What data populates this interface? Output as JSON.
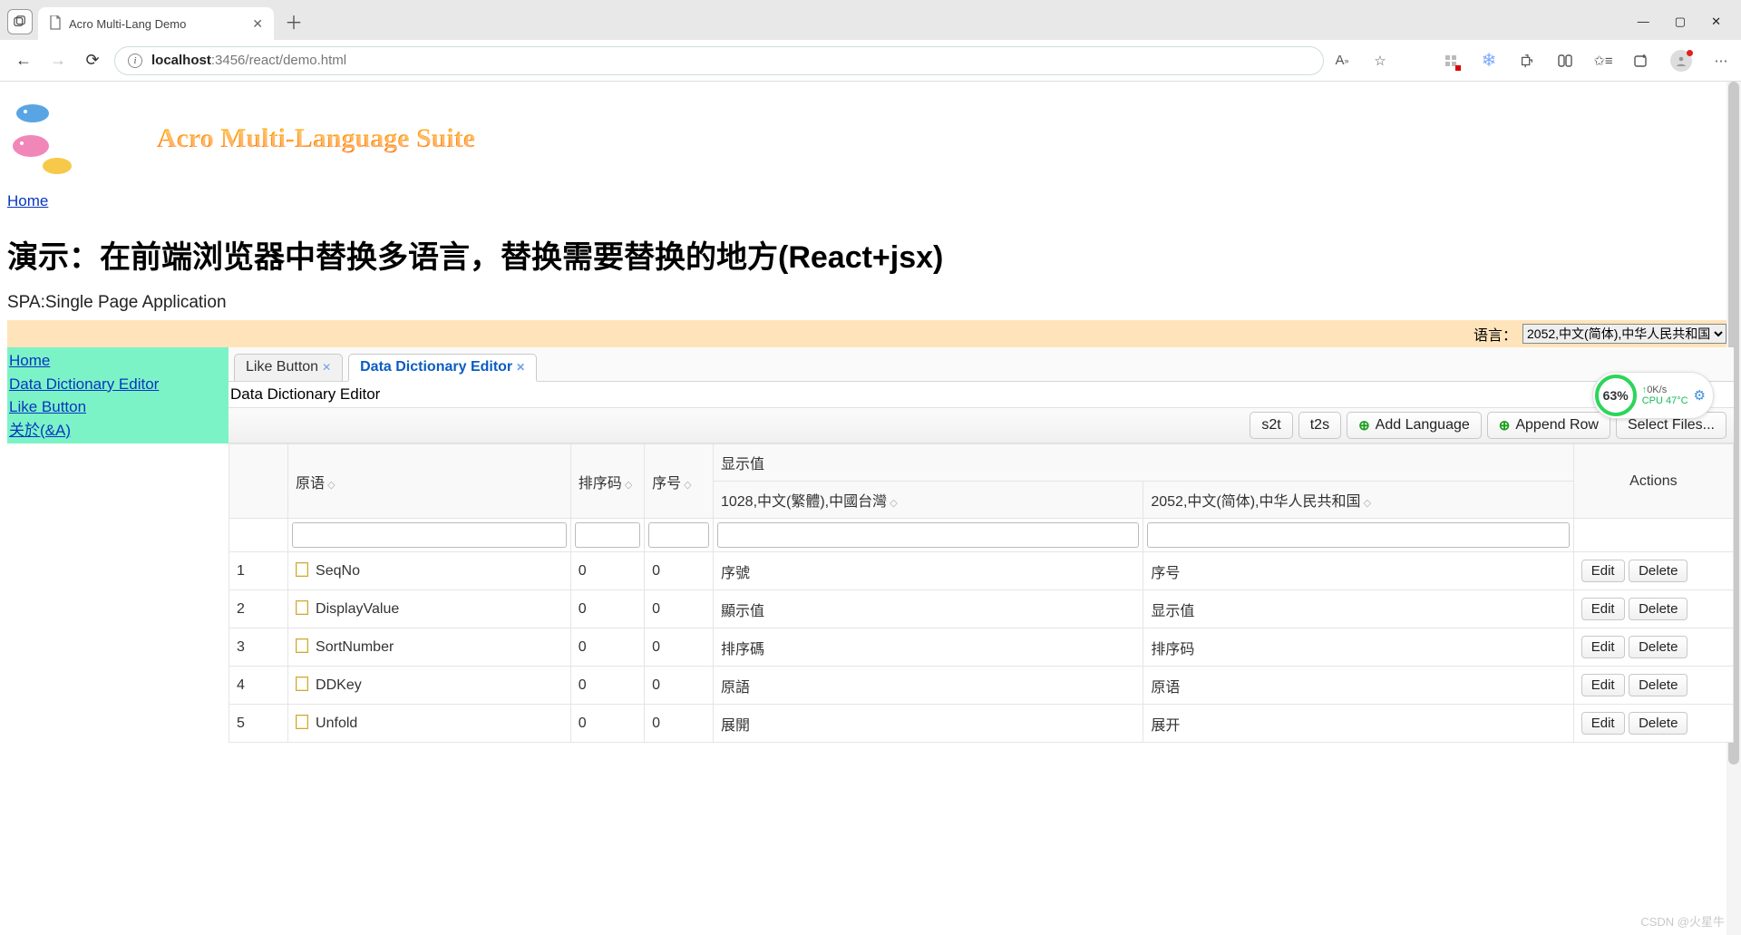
{
  "browser": {
    "tab_title": "Acro Multi-Lang Demo",
    "url_host": "localhost",
    "url_path": ":3456/react/demo.html"
  },
  "logo_text": "Acro Multi-Language Suite",
  "top_home_link": "Home",
  "page_title": "演示：在前端浏览器中替换多语言，替换需要替换的地方(React+jsx)",
  "subhead": "SPA:Single Page Application",
  "lang_bar": {
    "label": "语言：",
    "selected": "2052,中文(简体),中华人民共和国"
  },
  "sidebar": [
    "Home",
    "Data Dictionary Editor",
    "Like Button",
    "关於(&A)"
  ],
  "tabs": {
    "like_button": "Like Button",
    "data_dict": "Data Dictionary Editor"
  },
  "editor_title": "Data Dictionary Editor",
  "toolbar": {
    "s2t": "s2t",
    "t2s": "t2s",
    "add_lang": "Add Language",
    "append_row": "Append Row",
    "select_files": "Select Files..."
  },
  "columns": {
    "primary": "原语",
    "sort_num": "排序码",
    "seq_no": "序号",
    "display_val": "显示值",
    "tw": "1028,中文(繁體),中國台灣",
    "cn": "2052,中文(简体),中华人民共和国",
    "actions": "Actions"
  },
  "actions": {
    "edit": "Edit",
    "delete": "Delete"
  },
  "rows": [
    {
      "n": "1",
      "pk": "SeqNo",
      "sn": "0",
      "seq": "0",
      "tw": "序號",
      "cn": "序号"
    },
    {
      "n": "2",
      "pk": "DisplayValue",
      "sn": "0",
      "seq": "0",
      "tw": "顯示值",
      "cn": "显示值"
    },
    {
      "n": "3",
      "pk": "SortNumber",
      "sn": "0",
      "seq": "0",
      "tw": "排序碼",
      "cn": "排序码"
    },
    {
      "n": "4",
      "pk": "DDKey",
      "sn": "0",
      "seq": "0",
      "tw": "原語",
      "cn": "原语"
    },
    {
      "n": "5",
      "pk": "Unfold",
      "sn": "0",
      "seq": "0",
      "tw": "展開",
      "cn": "展开"
    }
  ],
  "perf": {
    "pct": "63%",
    "net": "0K/s",
    "cpu_label": "CPU ",
    "cpu_val": "47°C"
  },
  "watermark": "CSDN @火星牛"
}
